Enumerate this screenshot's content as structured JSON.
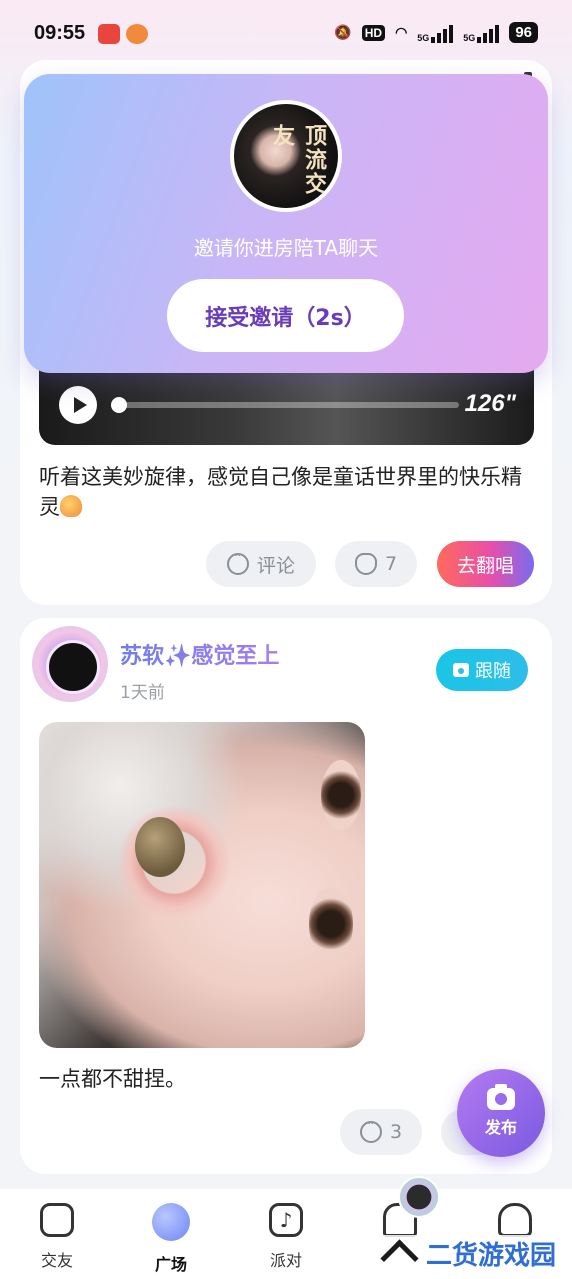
{
  "status_bar": {
    "time": "09:55",
    "hd_label": "HD",
    "net_labels": [
      "5G",
      "5G"
    ],
    "battery": "96"
  },
  "invite": {
    "avatar_text": "顶流交友",
    "message": "邀请你进房陪TA聊天",
    "accept_label": "接受邀请（2s）"
  },
  "post1": {
    "duration": "126\"",
    "text": "听着这美妙旋律，感觉自己像是童话世界里的快乐精灵",
    "comment_label": "评论",
    "like_count": "7",
    "cover_label": "去翻唱"
  },
  "post2": {
    "username": "苏软✨感觉至上",
    "time_ago": "1天前",
    "follow_label": "跟随",
    "text": "一点都不甜捏。",
    "comment_count": "3"
  },
  "fab": {
    "label": "发布"
  },
  "nav": {
    "items": [
      {
        "label": "交友"
      },
      {
        "label": "广场"
      },
      {
        "label": "派对"
      },
      {
        "label": ""
      },
      {
        "label": ""
      }
    ]
  },
  "watermark": "二货游戏园"
}
